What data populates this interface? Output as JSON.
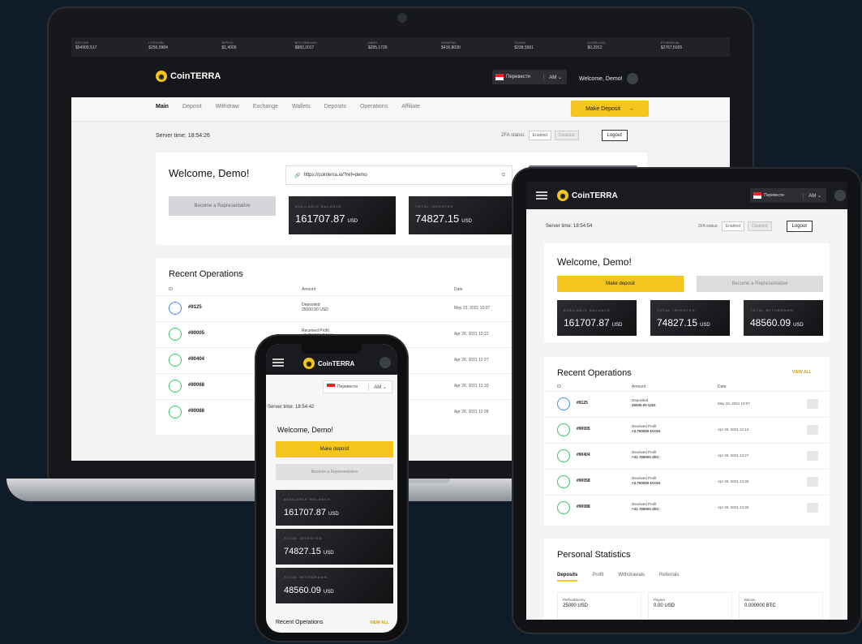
{
  "brand": {
    "name": "CoinTERRA",
    "accent": "#f4c51c",
    "bg": "#0f1b26"
  },
  "ticker": [
    {
      "name": "BITCOIN",
      "value": "$54909,517"
    },
    {
      "name": "LITECOIN",
      "value": "$256,9984"
    },
    {
      "name": "RIPPLE",
      "value": "$1,4006"
    },
    {
      "name": "BITCOINCASH",
      "value": "$882,2017"
    },
    {
      "name": "DASH",
      "value": "$285,1726"
    },
    {
      "name": "MONERO",
      "value": "$416,8030"
    },
    {
      "name": "ZCASH",
      "value": "$238,5561"
    },
    {
      "name": "DOGECOIN",
      "value": "$0,2912"
    },
    {
      "name": "ETHEREUM",
      "value": "$2767,5026"
    }
  ],
  "nav": {
    "translate": "Перевести",
    "lang": "AM",
    "welcome": "Welcome, Demo!",
    "menu": [
      "Main",
      "Deposit",
      "Withdraw",
      "Exchange",
      "Wallets",
      "Deposits",
      "Operations",
      "Affiliate"
    ],
    "make_deposit": "Make Deposit",
    "make_deposit_arrow": "→"
  },
  "laptop": {
    "server_time_label": "Server time:",
    "server_time": "18:54:26",
    "twofa_label": "2FA status:",
    "twofa_enabled": "Enabled",
    "twofa_disabled": "Disabled",
    "logout": "Logout",
    "welcome_title": "Welcome, Demo!",
    "ref_link": "https://cointerra.io/?ref=demo",
    "become_rep": "Become a Representative",
    "balance_label": "AVAILABLE BALANCE",
    "balance_value": "161707.87",
    "balance_unit": "USD",
    "invested_label": "TOTAL INVESTED",
    "invested_value": "74827.15",
    "invested_unit": "USD",
    "recent_title": "Recent Operations",
    "col_id": "ID",
    "col_amount": "Amount",
    "col_date": "Date",
    "rows": [
      {
        "id": "#9125",
        "type": "Deposited",
        "amount": "25000.00 USD",
        "date": "May 23, 2021 10:07",
        "status": "deposit"
      },
      {
        "id": "#90005",
        "type": "Received Profit",
        "amount": "+2.750000 DASH",
        "date": "Apr 26, 2021 12:12",
        "status": "ok"
      },
      {
        "id": "#90404",
        "type": "",
        "amount": "",
        "date": "Apr 26, 2021 12:27",
        "status": "ok"
      },
      {
        "id": "#90068",
        "type": "",
        "amount": "",
        "date": "Apr 26, 2021 12:33",
        "status": "ok"
      },
      {
        "id": "#90088",
        "type": "",
        "amount": "",
        "date": "Apr 26, 2021 12:28",
        "status": "ok"
      }
    ]
  },
  "tablet": {
    "server_time_label": "Server time:",
    "server_time": "18:54:54",
    "twofa_label": "2FA status:",
    "twofa_enabled": "Enabled",
    "twofa_disabled": "Disabled",
    "logout": "Logout",
    "welcome_title": "Welcome, Demo!",
    "make_deposit": "Make deposit",
    "become_rep": "Become a Representative",
    "balance_label": "AVAILABLE BALANCE",
    "balance_value": "161707.87",
    "invested_label": "TOTAL INVESTED",
    "invested_value": "74827.15",
    "withdrawn_label": "TOTAL WITHDRAWN",
    "withdrawn_value": "48560.09",
    "unit": "USD",
    "recent_title": "Recent Operations",
    "view_all": "VIEW ALL",
    "col_id": "ID",
    "col_amount": "Amount",
    "col_date": "Date",
    "rows": [
      {
        "id": "#9125",
        "type": "Deposited",
        "amount": "25000.00 USD",
        "date": "May 23, 2021 10:07",
        "status": "deposit"
      },
      {
        "id": "#90005",
        "type": "Received Profit",
        "amount": "+2.750000 DASH",
        "date": "Apr 26, 2021 12:12",
        "status": "ok"
      },
      {
        "id": "#90404",
        "type": "Received Profit",
        "amount": "+31.769000 ZEC",
        "date": "Apr 26, 2021 12:27",
        "status": "ok"
      },
      {
        "id": "#90058",
        "type": "Received Profit",
        "amount": "+2.750000 DASH",
        "date": "Apr 26, 2021 12:33",
        "status": "ok"
      },
      {
        "id": "#90088",
        "type": "Received Profit",
        "amount": "+31.769000 ZEC",
        "date": "Apr 26, 2021 12:33",
        "status": "ok"
      }
    ],
    "stats_title": "Personal Statistics",
    "stats_tabs": [
      "Deposits",
      "Profit",
      "Withdrawals",
      "Referrals"
    ],
    "stats_cells": [
      {
        "name": "PerfectMoney",
        "value": "25000 USD"
      },
      {
        "name": "Payeer",
        "value": "0.00 USD"
      },
      {
        "name": "Bitcoin",
        "value": "0.000000 BTC"
      }
    ]
  },
  "phone": {
    "server_time_label": "Server time:",
    "server_time": "18:54:42",
    "welcome_title": "Welcome, Demo!",
    "make_deposit": "Make deposit",
    "become_rep": "Become a Representative",
    "balance_label": "AVAILABLE BALANCE",
    "balance_value": "161707.87",
    "invested_label": "TOTAL INVESTED",
    "invested_value": "74827.15",
    "withdrawn_label": "TOTAL WITHDRAWN",
    "withdrawn_value": "48560.09",
    "unit": "USD",
    "recent_title": "Recent Operations",
    "view_all": "VIEW ALL"
  }
}
